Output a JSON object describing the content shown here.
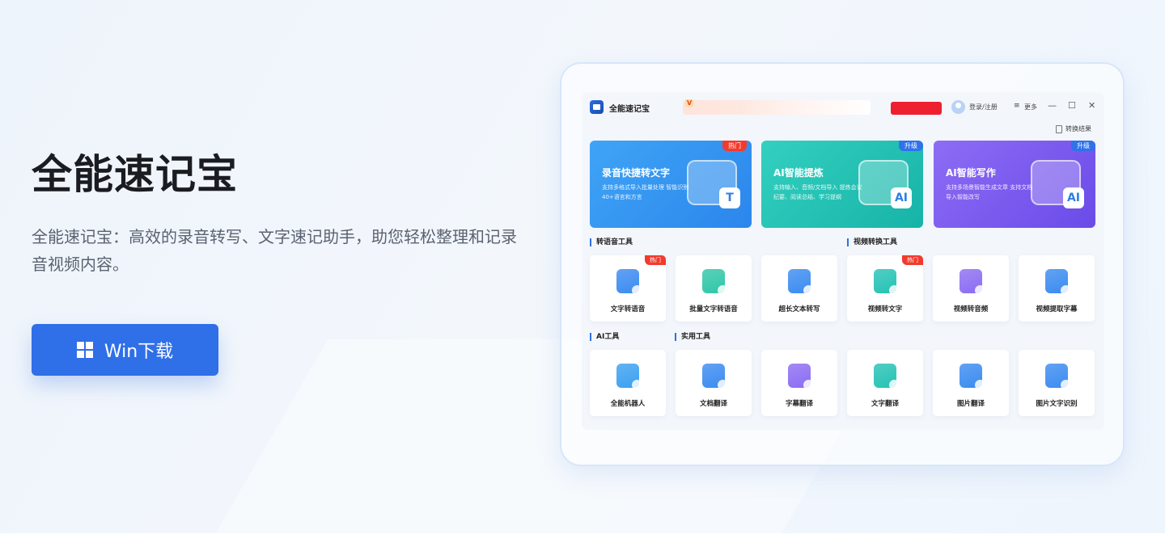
{
  "hero": {
    "title": "全能速记宝",
    "description": "全能速记宝：高效的录音转写、文字速记助手，助您轻松整理和记录音视频内容。",
    "download_label": "Win下载"
  },
  "app": {
    "name": "全能速记宝",
    "promo_badge": "V",
    "login_label": "登录/注册",
    "menu_icon": "≡",
    "more_label": "更多",
    "controls": {
      "minimize": "—",
      "maximize": "☐",
      "close": "✕"
    },
    "result_label": "转换结果",
    "feature_cards": [
      {
        "title": "录音快捷转文字",
        "desc": "支持多格式导入批量处理 智能识别40+语言和方言",
        "tag": "热门",
        "icon": "T",
        "color": "#3fa4f5",
        "color2": "#2b86ec"
      },
      {
        "title": "AI智能提炼",
        "desc": "支持输入、音频/文档导入 提炼会议纪要、阅读总结、学习提纲",
        "tag": "升级",
        "icon": "AI",
        "color": "#33d0c0",
        "color2": "#17b3a8"
      },
      {
        "title": "AI智能写作",
        "desc": "支持多场景智能生成文章 支持文档导入智能改写",
        "tag": "升级",
        "icon": "AI",
        "color": "#8d6cf5",
        "color2": "#6a4be8"
      }
    ],
    "sections": {
      "speech": "转语音工具",
      "video": "视频转换工具",
      "ai": "AI工具",
      "utility": "实用工具"
    },
    "tools_row1": [
      {
        "name": "文字转语音",
        "tag": "热门",
        "color": "#3b8bf0"
      },
      {
        "name": "批量文字转语音",
        "tag": "",
        "color": "#2fc6a8"
      },
      {
        "name": "超长文本转写",
        "tag": "",
        "color": "#3b8bf0"
      },
      {
        "name": "视频转文字",
        "tag": "热门",
        "color": "#25c2b4"
      },
      {
        "name": "视频转音频",
        "tag": "",
        "color": "#8b6cf2"
      },
      {
        "name": "视频提取字幕",
        "tag": "",
        "color": "#3b8bf0"
      }
    ],
    "tools_row2": [
      {
        "name": "全能机器人",
        "tag": "",
        "color": "#3ba0f0"
      },
      {
        "name": "文档翻译",
        "tag": "",
        "color": "#3b8bf0"
      },
      {
        "name": "字幕翻译",
        "tag": "",
        "color": "#8b6cf2"
      },
      {
        "name": "文字翻译",
        "tag": "",
        "color": "#25c2b4"
      },
      {
        "name": "图片翻译",
        "tag": "",
        "color": "#3b8bf0"
      },
      {
        "name": "图片文字识别",
        "tag": "",
        "color": "#3b8bf0"
      }
    ]
  }
}
